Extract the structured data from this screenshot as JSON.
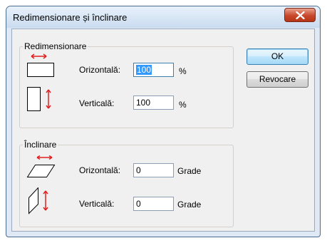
{
  "window": {
    "title": "Redimensionare și înclinare"
  },
  "resize": {
    "legend": "Redimensionare",
    "horizontal_label": "Orizontală:",
    "horizontal_value": "100",
    "horizontal_unit": "%",
    "vertical_label": "Verticală:",
    "vertical_value": "100",
    "vertical_unit": "%"
  },
  "skew": {
    "legend": "Înclinare",
    "horizontal_label": "Orizontală:",
    "horizontal_value": "0",
    "horizontal_unit": "Grade",
    "vertical_label": "Verticală:",
    "vertical_value": "0",
    "vertical_unit": "Grade"
  },
  "buttons": {
    "ok": "OK",
    "cancel": "Revocare"
  },
  "icons": {
    "close": "close-icon",
    "resize_horizontal": "resize-horizontal-icon",
    "resize_vertical": "resize-vertical-icon",
    "skew_horizontal": "skew-horizontal-icon",
    "skew_vertical": "skew-vertical-icon"
  },
  "colors": {
    "arrow": "#e02020",
    "close_button": "#c8482c",
    "selection": "#3399ff"
  }
}
